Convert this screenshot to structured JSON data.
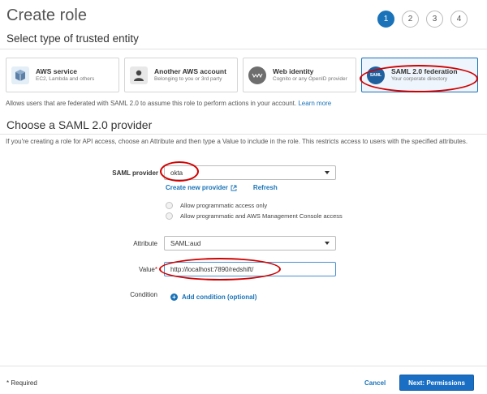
{
  "header": {
    "title": "Create role"
  },
  "steps": [
    "1",
    "2",
    "3",
    "4"
  ],
  "trusted_entity": {
    "heading": "Select type of trusted entity",
    "cards": [
      {
        "title": "AWS service",
        "subtitle": "EC2, Lambda and others",
        "icon": "cube-icon"
      },
      {
        "title": "Another AWS account",
        "subtitle": "Belonging to you or 3rd party",
        "icon": "person-icon"
      },
      {
        "title": "Web identity",
        "subtitle": "Cognito or any OpenID provider",
        "icon": "www-icon"
      },
      {
        "title": "SAML 2.0 federation",
        "subtitle": "Your corporate directory",
        "icon": "saml-icon",
        "icon_text": "SAML"
      }
    ],
    "description": "Allows users that are federated with SAML 2.0 to assume this role to perform actions in your account.",
    "learn_more": "Learn more"
  },
  "saml": {
    "heading": "Choose a SAML 2.0 provider",
    "description": "If you're creating a role for API access, choose an Attribute and then type a Value to include in the role. This restricts access to users with the specified attributes.",
    "provider_label": "SAML provider",
    "provider_value": "okta",
    "create_provider": "Create new provider",
    "refresh": "Refresh",
    "access_options": [
      "Allow programmatic access only",
      "Allow programmatic and AWS Management Console access"
    ],
    "attribute_label": "Attribute",
    "attribute_value": "SAML:aud",
    "value_label": "Value",
    "value_required_mark": "*",
    "value_value": "http://localhost:7890/redshift/",
    "condition_label": "Condition",
    "add_condition": "Add condition (optional)"
  },
  "footer": {
    "required_note": "* Required",
    "cancel": "Cancel",
    "next": "Next: Permissions"
  },
  "colors": {
    "accent": "#1a73b8",
    "annotation": "#d10000"
  }
}
